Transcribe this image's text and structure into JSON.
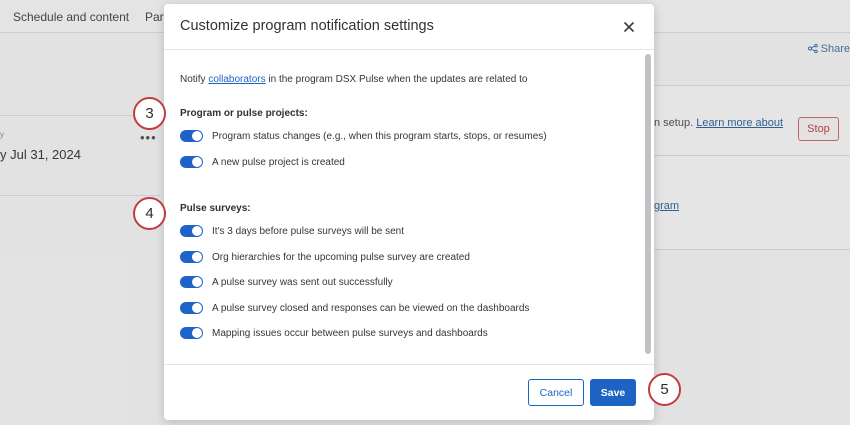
{
  "background": {
    "tabs": [
      "Schedule and content",
      "Parti"
    ],
    "share_label": "Share",
    "date_text": "y Jul 31, 2024",
    "small_text": "y",
    "dots": "•••",
    "setup_text": "n setup.",
    "learn_more_link": "Learn more about",
    "stop_button": "Stop",
    "gram_link": "gram"
  },
  "modal": {
    "title": "Customize program notification settings",
    "intro_before": "Notify ",
    "intro_link": "collaborators",
    "intro_after": " in the program DSX Pulse when the updates are related to",
    "sections": [
      {
        "heading": "Program or pulse projects:",
        "toggles": [
          {
            "label": "Program status changes (e.g., when this program starts, stops, or resumes)",
            "on": true
          },
          {
            "label": "A new pulse project is created",
            "on": true
          }
        ]
      },
      {
        "heading": "Pulse surveys:",
        "toggles": [
          {
            "label": "It's 3 days before pulse surveys will be sent",
            "on": true
          },
          {
            "label": "Org hierarchies for the upcoming pulse survey are created",
            "on": true
          },
          {
            "label": "A pulse survey was sent out successfully",
            "on": true
          },
          {
            "label": "A pulse survey closed and responses can be viewed on the dashboards",
            "on": true
          },
          {
            "label": "Mapping issues occur between pulse surveys and dashboards",
            "on": true
          }
        ]
      }
    ],
    "cancel_label": "Cancel",
    "save_label": "Save"
  },
  "steps": [
    "3",
    "4",
    "5"
  ],
  "colors": {
    "accent": "#1d63c4",
    "toggle_on": "#1e63c8",
    "step_border": "#c23b3f",
    "stop_red": "#b74a4a"
  },
  "icons": {
    "close": "close-icon",
    "share": "share-icon",
    "more": "more-dots-icon"
  }
}
